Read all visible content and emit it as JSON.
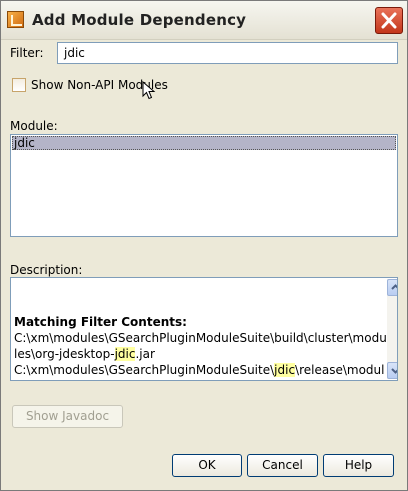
{
  "window": {
    "title": "Add Module Dependency"
  },
  "filter": {
    "label": "Filter:",
    "value": "jdic"
  },
  "show_non_api": {
    "label": "Show Non-API Modules",
    "checked": false
  },
  "module": {
    "label": "Module:",
    "items": [
      "jdic"
    ],
    "selected": "jdic"
  },
  "description": {
    "label": "Description:",
    "heading": "Matching Filter Contents:",
    "line1": "C:\\xm\\modules\\GSearchPluginModuleSuite\\build\\cluster\\modu",
    "line2_pre": "les\\org-jdesktop-",
    "line2_hl": "jdic",
    "line2_post": ".jar",
    "line3_pre": "C:\\xm\\modules\\GSearchPluginModuleSuite\\",
    "line3_hl": "jdic",
    "line3_post": "\\release\\modul"
  },
  "buttons": {
    "javadoc": "Show Javadoc",
    "ok": "OK",
    "cancel": "Cancel",
    "help": "Help"
  },
  "icons": [
    "app-icon",
    "close-icon",
    "scroll-up-icon",
    "scroll-down-icon",
    "mouse-cursor-icon"
  ],
  "colors": {
    "selection": "#b4b4c8",
    "highlight": "#ffffa0",
    "close": "#c3361a"
  }
}
